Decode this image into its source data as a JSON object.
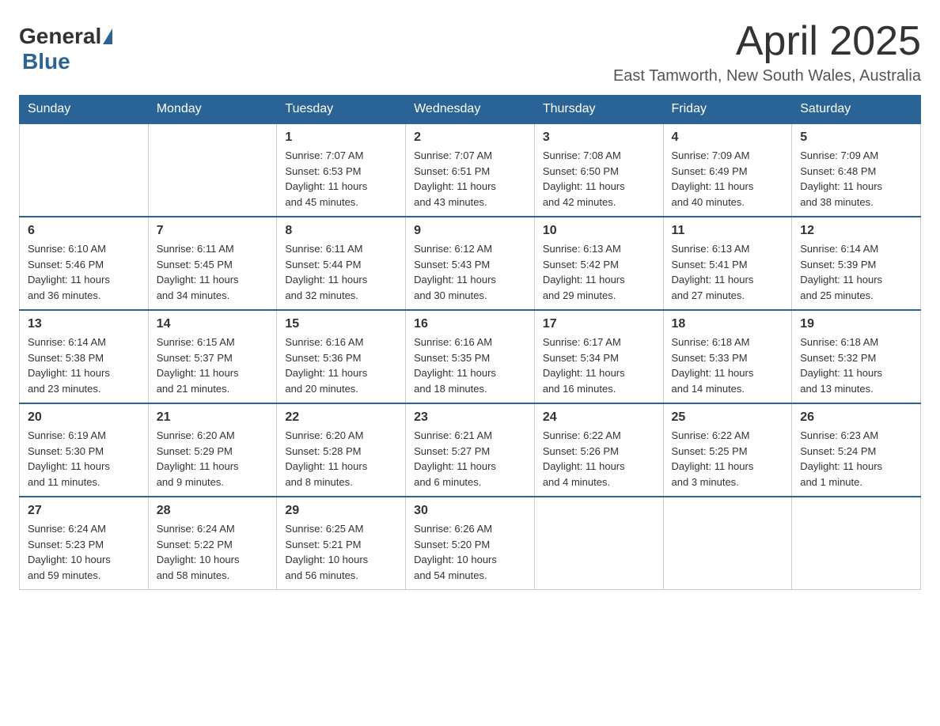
{
  "header": {
    "logo_general": "General",
    "logo_blue": "Blue",
    "month_title": "April 2025",
    "location": "East Tamworth, New South Wales, Australia"
  },
  "days_of_week": [
    "Sunday",
    "Monday",
    "Tuesday",
    "Wednesday",
    "Thursday",
    "Friday",
    "Saturday"
  ],
  "weeks": [
    [
      {
        "day": "",
        "info": ""
      },
      {
        "day": "",
        "info": ""
      },
      {
        "day": "1",
        "info": "Sunrise: 7:07 AM\nSunset: 6:53 PM\nDaylight: 11 hours\nand 45 minutes."
      },
      {
        "day": "2",
        "info": "Sunrise: 7:07 AM\nSunset: 6:51 PM\nDaylight: 11 hours\nand 43 minutes."
      },
      {
        "day": "3",
        "info": "Sunrise: 7:08 AM\nSunset: 6:50 PM\nDaylight: 11 hours\nand 42 minutes."
      },
      {
        "day": "4",
        "info": "Sunrise: 7:09 AM\nSunset: 6:49 PM\nDaylight: 11 hours\nand 40 minutes."
      },
      {
        "day": "5",
        "info": "Sunrise: 7:09 AM\nSunset: 6:48 PM\nDaylight: 11 hours\nand 38 minutes."
      }
    ],
    [
      {
        "day": "6",
        "info": "Sunrise: 6:10 AM\nSunset: 5:46 PM\nDaylight: 11 hours\nand 36 minutes."
      },
      {
        "day": "7",
        "info": "Sunrise: 6:11 AM\nSunset: 5:45 PM\nDaylight: 11 hours\nand 34 minutes."
      },
      {
        "day": "8",
        "info": "Sunrise: 6:11 AM\nSunset: 5:44 PM\nDaylight: 11 hours\nand 32 minutes."
      },
      {
        "day": "9",
        "info": "Sunrise: 6:12 AM\nSunset: 5:43 PM\nDaylight: 11 hours\nand 30 minutes."
      },
      {
        "day": "10",
        "info": "Sunrise: 6:13 AM\nSunset: 5:42 PM\nDaylight: 11 hours\nand 29 minutes."
      },
      {
        "day": "11",
        "info": "Sunrise: 6:13 AM\nSunset: 5:41 PM\nDaylight: 11 hours\nand 27 minutes."
      },
      {
        "day": "12",
        "info": "Sunrise: 6:14 AM\nSunset: 5:39 PM\nDaylight: 11 hours\nand 25 minutes."
      }
    ],
    [
      {
        "day": "13",
        "info": "Sunrise: 6:14 AM\nSunset: 5:38 PM\nDaylight: 11 hours\nand 23 minutes."
      },
      {
        "day": "14",
        "info": "Sunrise: 6:15 AM\nSunset: 5:37 PM\nDaylight: 11 hours\nand 21 minutes."
      },
      {
        "day": "15",
        "info": "Sunrise: 6:16 AM\nSunset: 5:36 PM\nDaylight: 11 hours\nand 20 minutes."
      },
      {
        "day": "16",
        "info": "Sunrise: 6:16 AM\nSunset: 5:35 PM\nDaylight: 11 hours\nand 18 minutes."
      },
      {
        "day": "17",
        "info": "Sunrise: 6:17 AM\nSunset: 5:34 PM\nDaylight: 11 hours\nand 16 minutes."
      },
      {
        "day": "18",
        "info": "Sunrise: 6:18 AM\nSunset: 5:33 PM\nDaylight: 11 hours\nand 14 minutes."
      },
      {
        "day": "19",
        "info": "Sunrise: 6:18 AM\nSunset: 5:32 PM\nDaylight: 11 hours\nand 13 minutes."
      }
    ],
    [
      {
        "day": "20",
        "info": "Sunrise: 6:19 AM\nSunset: 5:30 PM\nDaylight: 11 hours\nand 11 minutes."
      },
      {
        "day": "21",
        "info": "Sunrise: 6:20 AM\nSunset: 5:29 PM\nDaylight: 11 hours\nand 9 minutes."
      },
      {
        "day": "22",
        "info": "Sunrise: 6:20 AM\nSunset: 5:28 PM\nDaylight: 11 hours\nand 8 minutes."
      },
      {
        "day": "23",
        "info": "Sunrise: 6:21 AM\nSunset: 5:27 PM\nDaylight: 11 hours\nand 6 minutes."
      },
      {
        "day": "24",
        "info": "Sunrise: 6:22 AM\nSunset: 5:26 PM\nDaylight: 11 hours\nand 4 minutes."
      },
      {
        "day": "25",
        "info": "Sunrise: 6:22 AM\nSunset: 5:25 PM\nDaylight: 11 hours\nand 3 minutes."
      },
      {
        "day": "26",
        "info": "Sunrise: 6:23 AM\nSunset: 5:24 PM\nDaylight: 11 hours\nand 1 minute."
      }
    ],
    [
      {
        "day": "27",
        "info": "Sunrise: 6:24 AM\nSunset: 5:23 PM\nDaylight: 10 hours\nand 59 minutes."
      },
      {
        "day": "28",
        "info": "Sunrise: 6:24 AM\nSunset: 5:22 PM\nDaylight: 10 hours\nand 58 minutes."
      },
      {
        "day": "29",
        "info": "Sunrise: 6:25 AM\nSunset: 5:21 PM\nDaylight: 10 hours\nand 56 minutes."
      },
      {
        "day": "30",
        "info": "Sunrise: 6:26 AM\nSunset: 5:20 PM\nDaylight: 10 hours\nand 54 minutes."
      },
      {
        "day": "",
        "info": ""
      },
      {
        "day": "",
        "info": ""
      },
      {
        "day": "",
        "info": ""
      }
    ]
  ]
}
